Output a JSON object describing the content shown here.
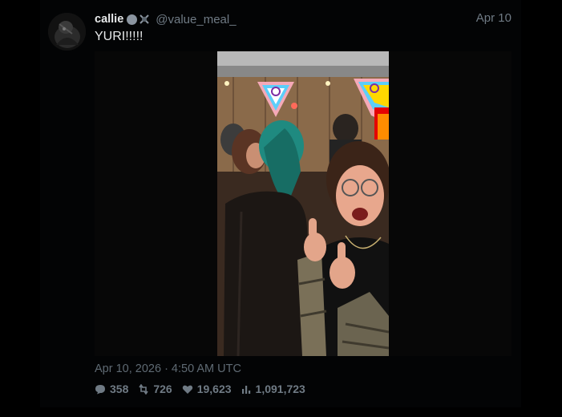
{
  "tweet": {
    "display_name": "callie",
    "handle": "@value_meal_",
    "date_short": "Apr 10",
    "text": "YURI!!!!!",
    "timestamp": "Apr 10, 2026 · 4:50 AM UTC",
    "stats": {
      "replies": "358",
      "retweets": "726",
      "likes": "19,623",
      "views": "1,091,723"
    }
  },
  "icons": {
    "reply": "speech-bubble-icon",
    "retweet": "retweet-icon",
    "like": "heart-icon",
    "views": "bar-chart-icon"
  },
  "colors": {
    "background": "#000000",
    "primary_text": "#e7e9ea",
    "secondary_text": "#6f7a84"
  }
}
